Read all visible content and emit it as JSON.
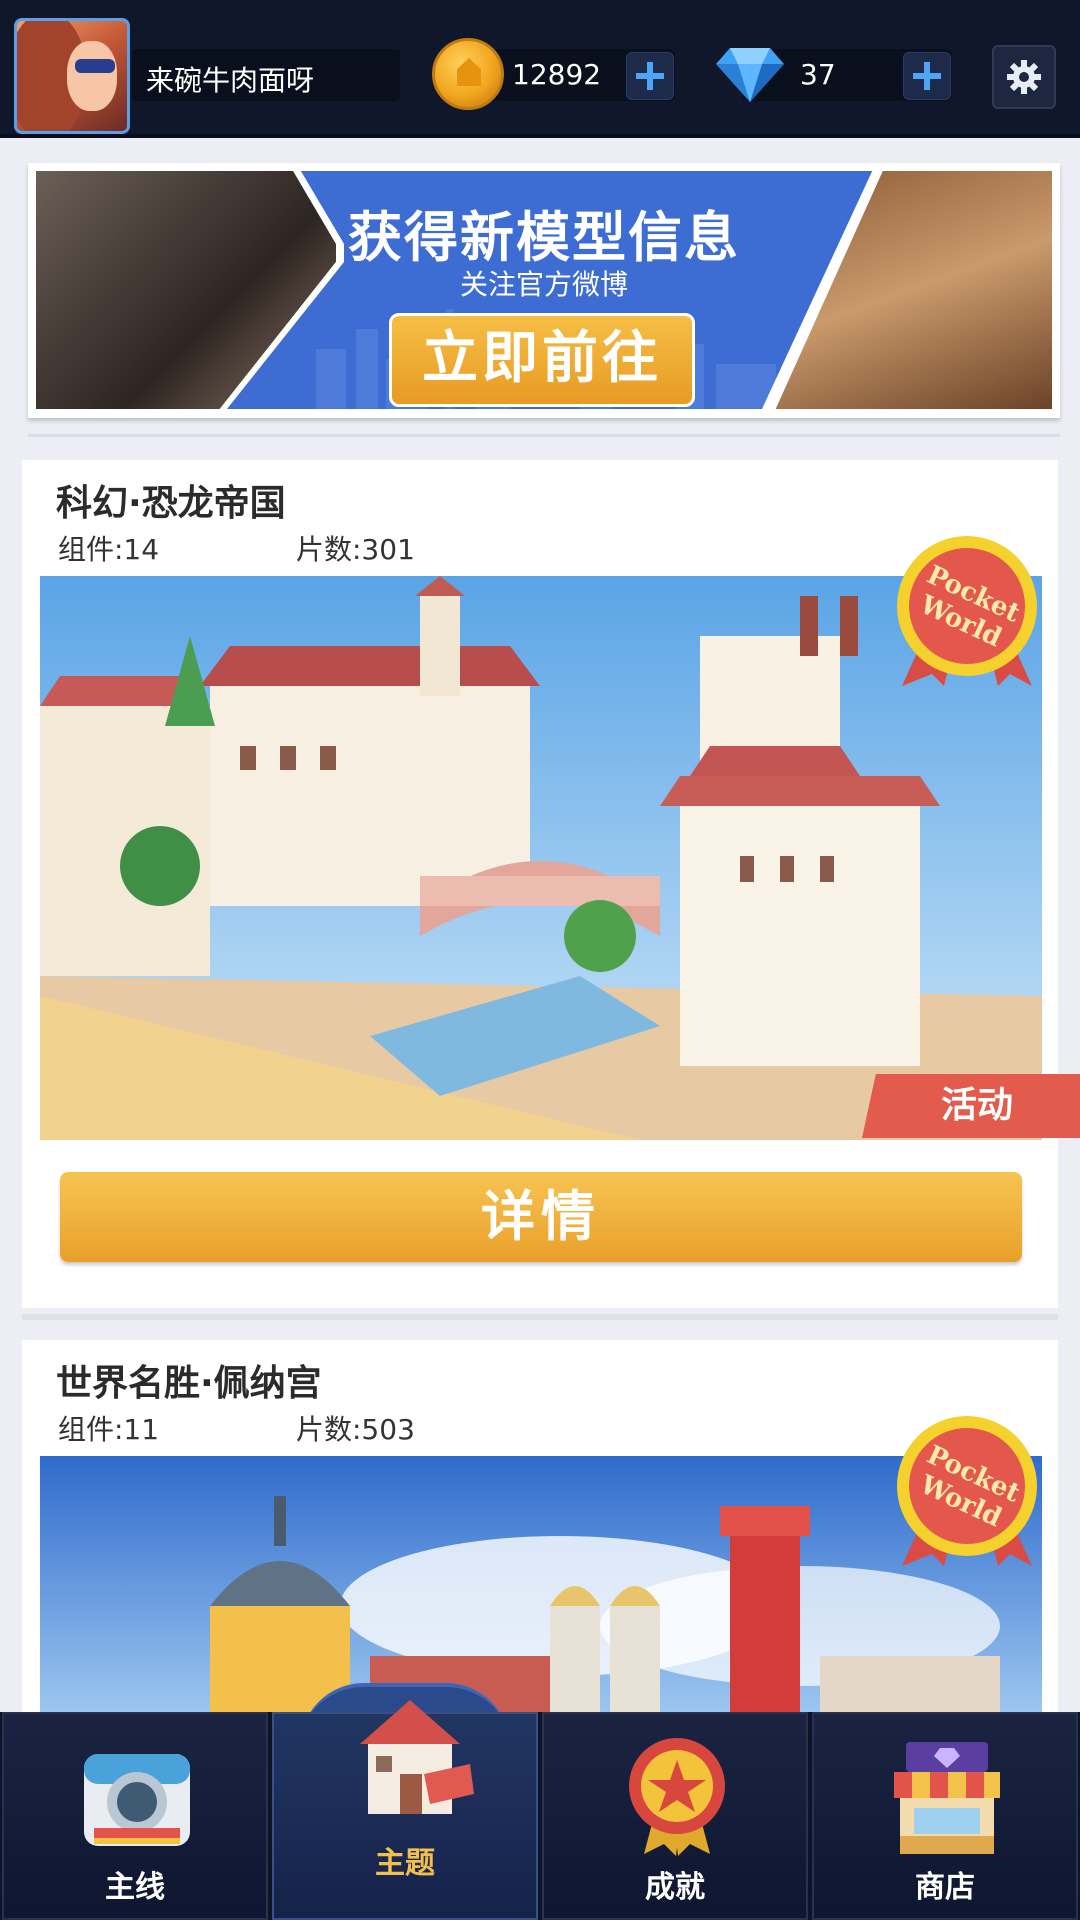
{
  "header": {
    "username": "来碗牛肉面呀",
    "coins": "12892",
    "gems": "37",
    "icons": {
      "avatar": "avatar",
      "coin": "coin-icon",
      "gem": "gem-icon",
      "add": "plus-icon",
      "settings": "gear-icon"
    },
    "colors": {
      "bar": "#10172a",
      "plus": "#4ea4f7"
    }
  },
  "banner": {
    "title": "获得新模型信息",
    "subtitle": "关注官方微博",
    "button": "立即前往",
    "colors": {
      "background": "#3d6cd2",
      "button": "#f1ae33"
    }
  },
  "themes": [
    {
      "title": "科幻·恐龙帝国",
      "components_label": "组件:14",
      "pieces_label": "片数:301",
      "badge_line1": "Pocket",
      "badge_line2": "World",
      "event_label": "活动",
      "button": "详情"
    },
    {
      "title": "世界名胜·佩纳宫",
      "components_label": "组件:11",
      "pieces_label": "片数:503",
      "badge_line1": "Pocket",
      "badge_line2": "World"
    }
  ],
  "nav": {
    "items": [
      {
        "label": "主线",
        "icon": "camera-icon"
      },
      {
        "label": "主题",
        "icon": "house-icon",
        "active": true
      },
      {
        "label": "成就",
        "icon": "medal-icon"
      },
      {
        "label": "商店",
        "icon": "shop-icon"
      }
    ],
    "colors": {
      "active_label": "#f2c04e"
    }
  }
}
